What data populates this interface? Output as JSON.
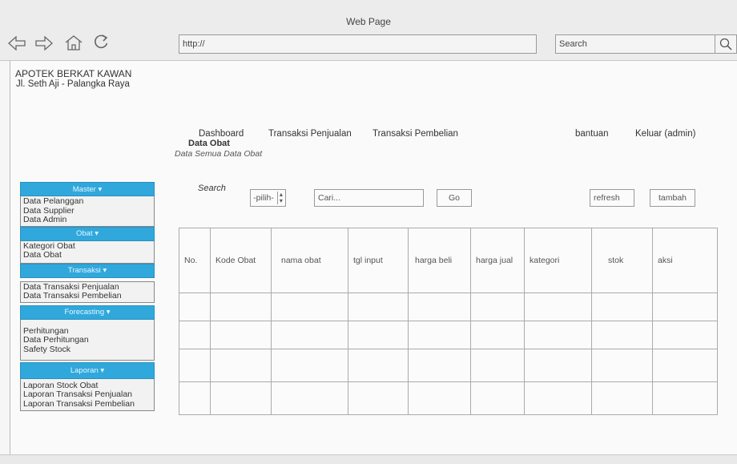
{
  "window": {
    "title": "Web Page"
  },
  "browser": {
    "url": "http://",
    "search_placeholder": "Search",
    "icons": [
      "back-arrow-icon",
      "forward-arrow-icon",
      "home-icon",
      "refresh-icon",
      "search-icon"
    ]
  },
  "brand": {
    "name": "APOTEK BERKAT KAWAN",
    "address": "Jl. Seth Aji - Palangka Raya"
  },
  "topnav": {
    "dashboard": "Dashboard",
    "sales": "Transaksi Penjualan",
    "purchase": "Transaksi Pembelian",
    "help": "bantuan",
    "logout": "Keluar (admin)"
  },
  "page": {
    "title": "Data Obat",
    "subtitle": "Data Semua Data Obat"
  },
  "sidebar": {
    "sections": [
      {
        "label": "Master ▾",
        "items": [
          "Data Pelanggan",
          "Data Supplier",
          "Data Admin"
        ]
      },
      {
        "label": "Obat ▾",
        "items": [
          "Kategori Obat",
          "Data Obat"
        ]
      },
      {
        "label": "Transaksi ▾",
        "items": [
          "Data Transaksi Penjualan",
          "Data Transaksi Pembelian"
        ]
      },
      {
        "label": "Forecasting ▾",
        "items": [
          "Perhitungan",
          "Data Perhitungan",
          "Safety Stock"
        ]
      },
      {
        "label": "Laporan ▾",
        "items": [
          "Laporan Stock Obat",
          "Laporan Transaksi Penjualan",
          "Laporan Transaksi Pembelian"
        ]
      }
    ]
  },
  "toolbar": {
    "search_label": "Search",
    "select_value": "-pilih-",
    "input_placeholder": "Cari...",
    "go": "Go",
    "refresh": "refresh",
    "add": "tambah"
  },
  "table": {
    "columns": [
      "No.",
      "Kode Obat",
      "nama obat",
      "tgl input",
      "harga beli",
      "harga jual",
      "kategori",
      "stok",
      "aksi"
    ],
    "rows": [
      [
        "",
        "",
        "",
        "",
        "",
        "",
        "",
        "",
        ""
      ],
      [
        "",
        "",
        "",
        "",
        "",
        "",
        "",
        "",
        ""
      ],
      [
        "",
        "",
        "",
        "",
        "",
        "",
        "",
        "",
        ""
      ],
      [
        "",
        "",
        "",
        "",
        "",
        "",
        "",
        "",
        ""
      ]
    ]
  },
  "colors": {
    "sidebar_header": "#30a8dc",
    "chrome": "#ececec"
  }
}
